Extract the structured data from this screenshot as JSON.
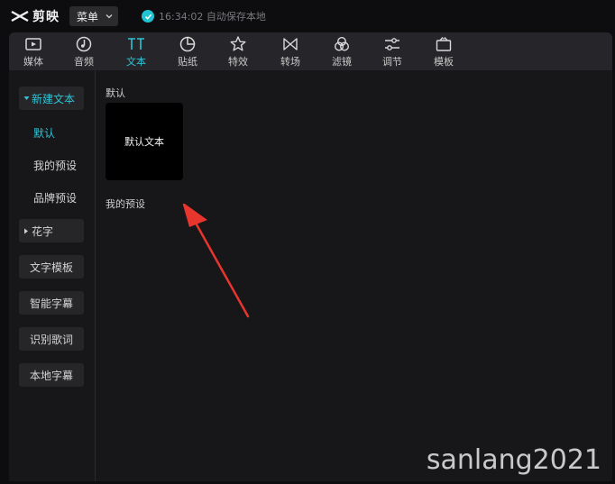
{
  "app": {
    "name": "剪映",
    "menu_label": "菜单",
    "save_status": "16:34:02 自动保存本地"
  },
  "colors": {
    "accent": "#2ec4d6",
    "panel_bg": "#171719",
    "toolbar_bg": "#26262a",
    "annotation_arrow": "#e8352e"
  },
  "toolbar": {
    "items": [
      {
        "label": "媒体",
        "icon": "media-icon"
      },
      {
        "label": "音频",
        "icon": "audio-icon"
      },
      {
        "label": "文本",
        "icon": "text-icon",
        "active": true
      },
      {
        "label": "贴纸",
        "icon": "sticker-icon"
      },
      {
        "label": "特效",
        "icon": "effects-icon"
      },
      {
        "label": "转场",
        "icon": "transition-icon"
      },
      {
        "label": "滤镜",
        "icon": "filter-icon"
      },
      {
        "label": "调节",
        "icon": "adjust-icon"
      },
      {
        "label": "模板",
        "icon": "template-icon"
      }
    ]
  },
  "sidebar": {
    "new_text": "新建文本",
    "sub_items": [
      "默认",
      "我的预设",
      "品牌预设"
    ],
    "fancy_text": "花字",
    "text_template": "文字模板",
    "smart_subtitle": "智能字幕",
    "recognize_lyrics": "识别歌词",
    "local_subtitle": "本地字幕"
  },
  "content": {
    "default_section": "默认",
    "default_card": "默认文本",
    "my_presets_section": "我的预设"
  },
  "watermark": "sanlang2021"
}
